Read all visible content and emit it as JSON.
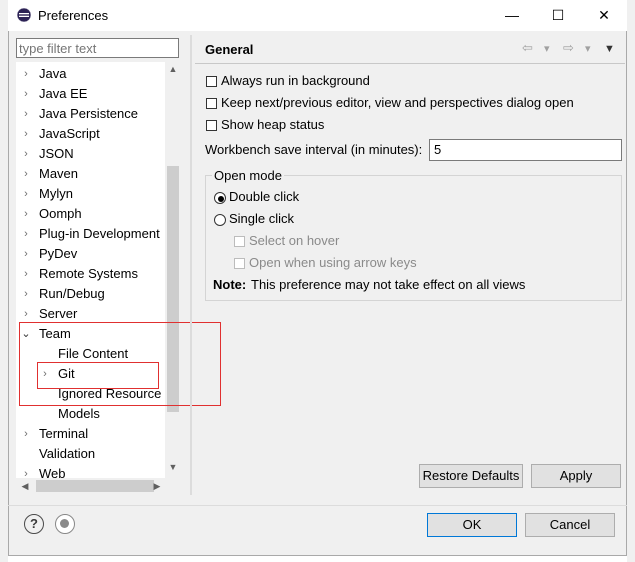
{
  "window": {
    "title": "Preferences",
    "minimize_glyph": "—",
    "maximize_glyph": "☐",
    "close_glyph": "✕"
  },
  "filter": {
    "placeholder": "type filter text"
  },
  "tree": {
    "items": [
      {
        "label": "Java",
        "expander": "›"
      },
      {
        "label": "Java EE",
        "expander": "›"
      },
      {
        "label": "Java Persistence",
        "expander": "›"
      },
      {
        "label": "JavaScript",
        "expander": "›"
      },
      {
        "label": "JSON",
        "expander": "›"
      },
      {
        "label": "Maven",
        "expander": "›"
      },
      {
        "label": "Mylyn",
        "expander": "›"
      },
      {
        "label": "Oomph",
        "expander": "›"
      },
      {
        "label": "Plug-in Development",
        "expander": "›"
      },
      {
        "label": "PyDev",
        "expander": "›"
      },
      {
        "label": "Remote Systems",
        "expander": "›"
      },
      {
        "label": "Run/Debug",
        "expander": "›"
      },
      {
        "label": "Server",
        "expander": "›"
      },
      {
        "label": "Team",
        "expander": "⌄"
      },
      {
        "label": "File Content",
        "expander": ""
      },
      {
        "label": "Git",
        "expander": "›"
      },
      {
        "label": "Ignored Resource",
        "expander": ""
      },
      {
        "label": "Models",
        "expander": ""
      },
      {
        "label": "Terminal",
        "expander": "›"
      },
      {
        "label": "Validation",
        "expander": ""
      },
      {
        "label": "Web",
        "expander": "›"
      }
    ]
  },
  "panel": {
    "title": "General",
    "nav_back": "⇦",
    "nav_forward": "⇨",
    "nav_dropdown": "▾",
    "view_menu": "▼",
    "always_run_background": "Always run in background",
    "keep_next_previous": "Keep next/previous editor, view and perspectives dialog open",
    "show_heap_status": "Show heap status",
    "save_interval_label": "Workbench save interval (in minutes):",
    "save_interval_value": "5",
    "open_mode": {
      "title": "Open mode",
      "double_click": "Double click",
      "single_click": "Single click",
      "select_on_hover": "Select on hover",
      "open_arrow_keys": "Open when using arrow keys",
      "note_label": "Note:",
      "note_text": "This preference may not take effect on all views"
    },
    "restore_defaults": "Restore Defaults",
    "apply": "Apply"
  },
  "footer": {
    "help_glyph": "?",
    "ok": "OK",
    "cancel": "Cancel"
  }
}
